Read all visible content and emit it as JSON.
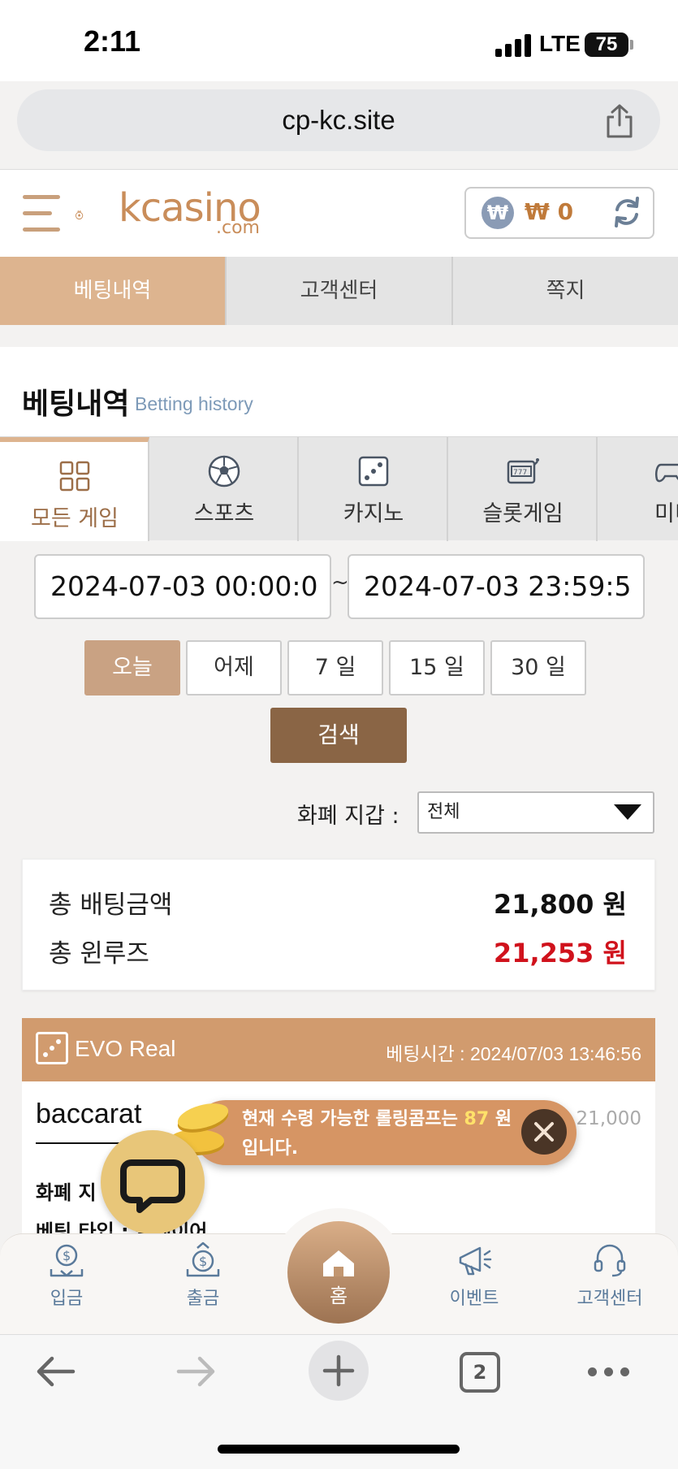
{
  "status_bar": {
    "time": "2:11",
    "network": "LTE",
    "battery": "75"
  },
  "browser": {
    "url": "cp-kc.site",
    "tab_count": "2"
  },
  "header": {
    "logo": {
      "name": "kcasino",
      "suffix": ".com"
    },
    "wallet_amount": "₩ 0",
    "wallet_icon_text": "₩"
  },
  "main_tabs": [
    {
      "label": "베팅내역",
      "active": true
    },
    {
      "label": "고객센터",
      "active": false
    },
    {
      "label": "쪽지",
      "active": false
    }
  ],
  "section": {
    "title": "베팅내역",
    "subtitle": "Betting history"
  },
  "game_tabs": [
    {
      "label": "모든 게임",
      "icon": "grid-icon",
      "active": true
    },
    {
      "label": "스포츠",
      "icon": "soccer-ball-icon",
      "active": false
    },
    {
      "label": "카지노",
      "icon": "dice-icon",
      "active": false
    },
    {
      "label": "슬롯게임",
      "icon": "slot-machine-icon",
      "active": false
    },
    {
      "label": "미니",
      "icon": "gamepad-icon",
      "active": false
    }
  ],
  "date_range": {
    "start": "2024-07-03 00:00:0",
    "separator": "~",
    "end": "2024-07-03 23:59:5"
  },
  "quick_ranges": [
    {
      "label": "오늘",
      "active": true
    },
    {
      "label": "어제",
      "active": false
    },
    {
      "label": "7 일",
      "active": false
    },
    {
      "label": "15 일",
      "active": false
    },
    {
      "label": "30 일",
      "active": false
    }
  ],
  "search_label": "검색",
  "currency_filter": {
    "label": "화폐 지갑 :",
    "selected": "전체"
  },
  "summary": {
    "total_bet_label": "총 배팅금액",
    "total_bet_value": "21,800 원",
    "win_loss_label": "총 윈루즈",
    "win_loss_value": "21,253 원"
  },
  "bet_card": {
    "provider": "EVO Real",
    "bet_time": "베팅시간 : 2024/07/03 13:46:56",
    "game": "baccarat",
    "amount_partial": ": 21,000",
    "row1_label": "화폐 지",
    "row2_label": "베팅 타입 : 플레이어"
  },
  "toast": {
    "text_before": "현재 수령 가능한 롤링콤프는",
    "amount": "87",
    "text_after": "원",
    "line2": "입니다."
  },
  "bottom_nav": [
    {
      "label": "입금",
      "icon": "deposit-icon"
    },
    {
      "label": "출금",
      "icon": "withdraw-icon"
    },
    {
      "label": "홈",
      "icon": "home-icon"
    },
    {
      "label": "이벤트",
      "icon": "megaphone-icon"
    },
    {
      "label": "고객센터",
      "icon": "headset-icon"
    }
  ],
  "colors": {
    "accent": "#ddb48f",
    "brand": "#c98d5a",
    "search_button": "#8a6545",
    "loss_red": "#d0121c",
    "card_header": "#d19b6e"
  }
}
